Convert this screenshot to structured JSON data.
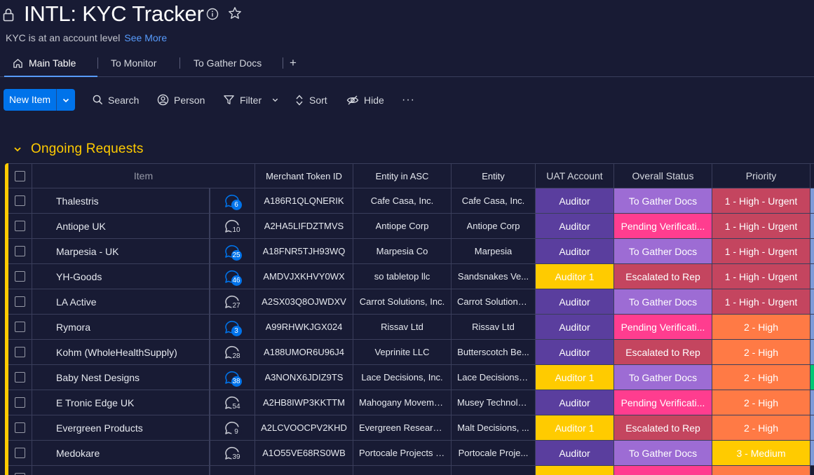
{
  "board": {
    "title": "INTL: KYC Tracker",
    "description": "KYC is at an account level",
    "see_more": "See More"
  },
  "icons": {
    "lock": "lock-icon",
    "info": "info-icon",
    "star": "star-icon",
    "home": "home-icon"
  },
  "tabs": [
    {
      "label": "Main Table",
      "active": true
    },
    {
      "label": "To Monitor",
      "active": false
    },
    {
      "label": "To Gather Docs",
      "active": false
    },
    {
      "label": "+",
      "active": false
    }
  ],
  "toolbar": {
    "new_item": "New Item",
    "search": "Search",
    "person": "Person",
    "filter": "Filter",
    "sort": "Sort",
    "hide": "Hide",
    "more": "···"
  },
  "group": {
    "title": "Ongoing Requests",
    "color": "#ffcb00"
  },
  "columns": [
    "Item",
    "Merchant Token ID",
    "Entity in ASC",
    "Entity",
    "UAT Account",
    "Overall Status",
    "Priority"
  ],
  "colors": {
    "auditor": "#5a3e9e",
    "auditor1": "#ffcb00",
    "to_gather_docs": "#9d6cd4",
    "pending_verification": "#ff3d8f",
    "escalated_to_rep": "#c4455f",
    "high_urgent": "#c4455f",
    "high": "#ff7a45",
    "medium": "#ffcb00"
  },
  "rows": [
    {
      "item": "Thalestris",
      "updates": "6",
      "unread": true,
      "token": "A186R1QLQNERIK",
      "asc": "Cafe Casa, Inc.",
      "entity": "Cafe Casa, Inc.",
      "uat": "Auditor",
      "status": "To Gather Docs",
      "priority": "1 - High - Urgent"
    },
    {
      "item": "Antiope UK",
      "updates": "10",
      "unread": false,
      "token": "A2HA5LIFDZTMVS",
      "asc": "Antiope Corp",
      "entity": "Antiope Corp",
      "uat": "Auditor",
      "status": "Pending Verificati...",
      "priority": "1 - High - Urgent"
    },
    {
      "item": "Marpesia - UK",
      "updates": "25",
      "unread": true,
      "token": "A18FNR5TJH93WQ",
      "asc": "Marpesia Co",
      "entity": "Marpesia",
      "uat": "Auditor",
      "status": "To Gather Docs",
      "priority": "1 - High - Urgent"
    },
    {
      "item": "YH-Goods",
      "updates": "46",
      "unread": true,
      "token": "AMDVJXKHVY0WX",
      "asc": "so tabletop llc",
      "entity": "Sandsnakes Ve...",
      "uat": "Auditor 1",
      "status": "Escalated to Rep",
      "priority": "1 - High - Urgent"
    },
    {
      "item": "LA Active",
      "updates": "27",
      "unread": false,
      "token": "A2SX03Q8OJWDXV",
      "asc": "Carrot Solutions, Inc.",
      "entity": "Carrot Solutions...",
      "uat": "Auditor",
      "status": "To Gather Docs",
      "priority": "1 - High - Urgent"
    },
    {
      "item": "Rymora",
      "updates": "3",
      "unread": true,
      "token": "A99RHWKJGX024",
      "asc": "Rissav Ltd",
      "entity": "Rissav Ltd",
      "uat": "Auditor",
      "status": "Pending Verificati...",
      "priority": "2 - High"
    },
    {
      "item": "Kohm (WholeHealthSupply)",
      "updates": "28",
      "unread": false,
      "token": "A188UMOR6U96J4",
      "asc": "Veprinite LLC",
      "entity": "Butterscotch Be...",
      "uat": "Auditor",
      "status": "Escalated to Rep",
      "priority": "2 - High"
    },
    {
      "item": "Baby Nest Designs",
      "updates": "38",
      "unread": true,
      "token": "A3NONX6JDIZ9TS",
      "asc": "Lace Decisions, Inc.",
      "entity": "Lace Decisions, ...",
      "uat": "Auditor 1",
      "status": "To Gather Docs",
      "priority": "2 - High"
    },
    {
      "item": "E Tronic Edge UK",
      "updates": "54",
      "unread": false,
      "token": "A2HB8IWP3KKTTM",
      "asc": "Mahogany Moveme...",
      "entity": "Musey Technolo...",
      "uat": "Auditor",
      "status": "Pending Verificati...",
      "priority": "2 - High"
    },
    {
      "item": "Evergreen Products",
      "updates": "9",
      "unread": false,
      "token": "A2LCVOOCPV2KHD",
      "asc": "Evergreen Research...",
      "entity": "Malt Decisions, ...",
      "uat": "Auditor 1",
      "status": "Escalated to Rep",
      "priority": "2 - High"
    },
    {
      "item": "Medokare",
      "updates": "39",
      "unread": false,
      "token": "A1O55VE68RS0WB",
      "asc": "Portocale Projects I...",
      "entity": "Portocale Proje...",
      "uat": "Auditor",
      "status": "To Gather Docs",
      "priority": "3 - Medium"
    }
  ]
}
